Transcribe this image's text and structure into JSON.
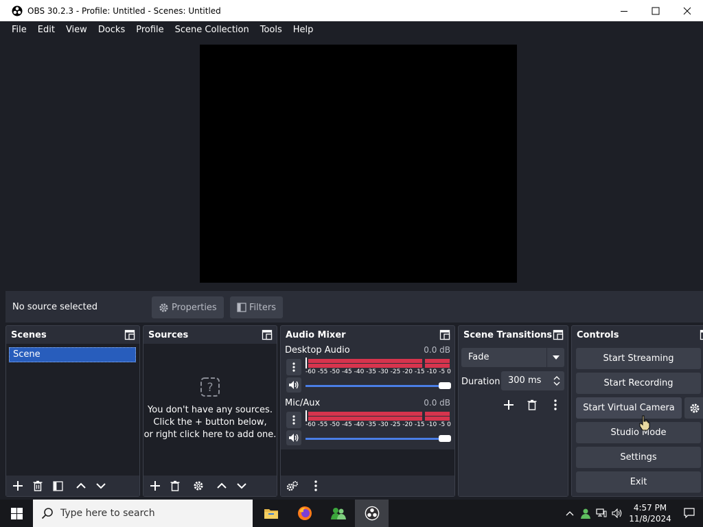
{
  "window": {
    "title": "OBS 30.2.3 - Profile: Untitled - Scenes: Untitled"
  },
  "menu": [
    "File",
    "Edit",
    "View",
    "Docks",
    "Profile",
    "Scene Collection",
    "Tools",
    "Help"
  ],
  "context": {
    "status": "No source selected",
    "properties_label": "Properties",
    "filters_label": "Filters"
  },
  "docks": {
    "scenes": {
      "title": "Scenes",
      "items": [
        "Scene"
      ]
    },
    "sources": {
      "title": "Sources",
      "empty_line1": "You don't have any sources.",
      "empty_line2": "Click the + button below,",
      "empty_line3": "or right click here to add one."
    },
    "mixer": {
      "title": "Audio Mixer",
      "ticks": [
        "-60",
        "-55",
        "-50",
        "-45",
        "-40",
        "-35",
        "-30",
        "-25",
        "-20",
        "-15",
        "-10",
        "-5",
        "0"
      ],
      "channels": [
        {
          "name": "Desktop Audio",
          "db": "0.0 dB"
        },
        {
          "name": "Mic/Aux",
          "db": "0.0 dB"
        }
      ]
    },
    "transitions": {
      "title": "Scene Transitions",
      "selected": "Fade",
      "duration_label": "Duration",
      "duration_value": "300 ms"
    },
    "controls": {
      "title": "Controls",
      "start_streaming": "Start Streaming",
      "start_recording": "Start Recording",
      "start_virtual_camera": "Start Virtual Camera",
      "studio_mode": "Studio Mode",
      "settings": "Settings",
      "exit": "Exit"
    }
  },
  "taskbar": {
    "search_placeholder": "Type here to search",
    "time": "4:57 PM",
    "date": "11/8/2024"
  },
  "colors": {
    "bg": "#1d1f26",
    "panel": "#2b2e38",
    "button": "#3c404b",
    "accent": "#285dbc",
    "meter": "#d7344d",
    "slider": "#4a7ee6"
  }
}
